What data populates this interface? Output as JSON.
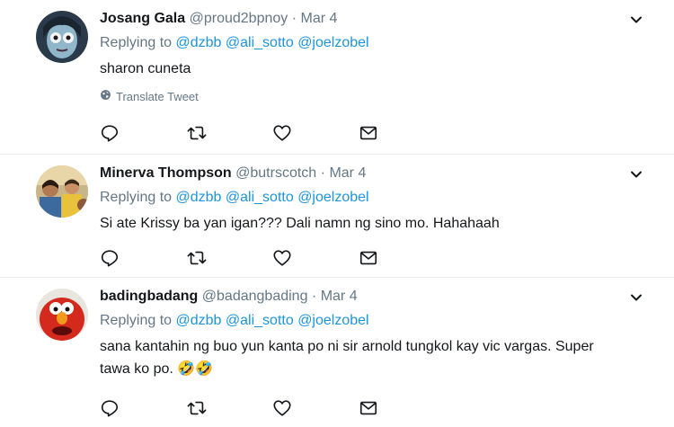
{
  "tweets": [
    {
      "name": "Josang Gala",
      "handle": "@proud2bpnoy",
      "separator": "·",
      "time": "Mar 4",
      "replying_prefix": "Replying to",
      "mentions": [
        "@dzbb",
        "@ali_sotto",
        "@joelzobel"
      ],
      "text": "sharon cuneta",
      "translate_label": "Translate Tweet"
    },
    {
      "name": "Minerva Thompson",
      "handle": "@butrscotch",
      "separator": "·",
      "time": "Mar 4",
      "replying_prefix": "Replying to",
      "mentions": [
        "@dzbb",
        "@ali_sotto",
        "@joelzobel"
      ],
      "text": "Si ate Krissy ba yan igan??? Dali namn ng sino mo. Hahahaah"
    },
    {
      "name": "badingbadang",
      "handle": "@badangbading",
      "separator": "·",
      "time": "Mar 4",
      "replying_prefix": "Replying to",
      "mentions": [
        "@dzbb",
        "@ali_sotto",
        "@joelzobel"
      ],
      "text_line1": "sana kantahin ng buo yun kanta po ni sir arnold tungkol kay vic vargas. Super",
      "text_line2": "tawa ko po. 🤣🤣"
    }
  ],
  "icons": {
    "reply": "reply-icon",
    "retweet": "retweet-icon",
    "like": "like-icon",
    "dm": "envelope-icon",
    "more": "chevron-down-icon",
    "translate": "globe-icon"
  },
  "colors": {
    "text": "#14171a",
    "secondary": "#657786",
    "link": "#1b95e0",
    "divider": "#e6ecf0"
  }
}
